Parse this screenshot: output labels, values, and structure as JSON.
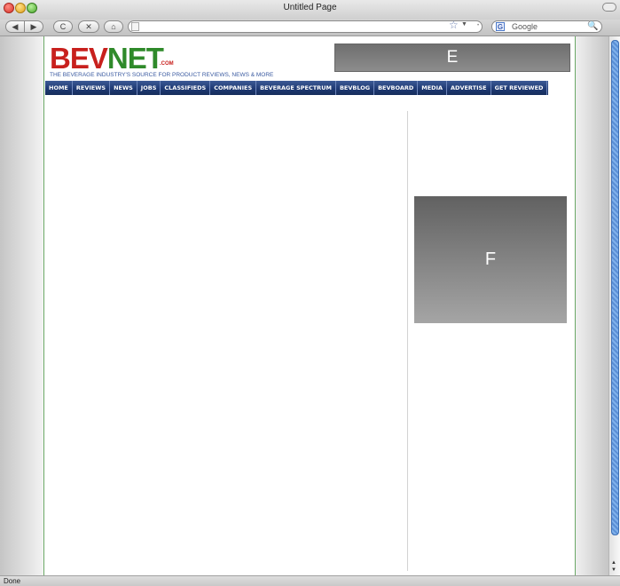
{
  "window": {
    "title": "Untitled Page"
  },
  "toolbar": {
    "back": "◀",
    "forward": "▶",
    "reload": "C",
    "stop": "✕",
    "home": "⌂",
    "url_value": "",
    "bookmark_star": "☆",
    "bookmark_drop": "▼",
    "search_engine_icon": "G",
    "search_placeholder": "Google",
    "search_icon": "🔍"
  },
  "site": {
    "logo_bev": "BEV",
    "logo_net": "NET",
    "logo_com": ".COM",
    "tagline": "THE BEVERAGE INDUSTRY'S SOURCE FOR PRODUCT REVIEWS, NEWS & MORE",
    "banner_label": "E",
    "nav": [
      "HOME",
      "REVIEWS",
      "NEWS",
      "JOBS",
      "CLASSIFIEDS",
      "COMPANIES",
      "BEVERAGE SPECTRUM",
      "BEVBLOG",
      "BEVBOARD",
      "MEDIA",
      "ADVERTISE",
      "GET REVIEWED"
    ],
    "sidebar_box_label": "F"
  },
  "statusbar": {
    "text": "Done"
  },
  "colors": {
    "brand_red": "#c8201d",
    "brand_green": "#2f8a2a",
    "nav_blue": "#1f3a74",
    "tagline_blue": "#3a5aa0"
  }
}
